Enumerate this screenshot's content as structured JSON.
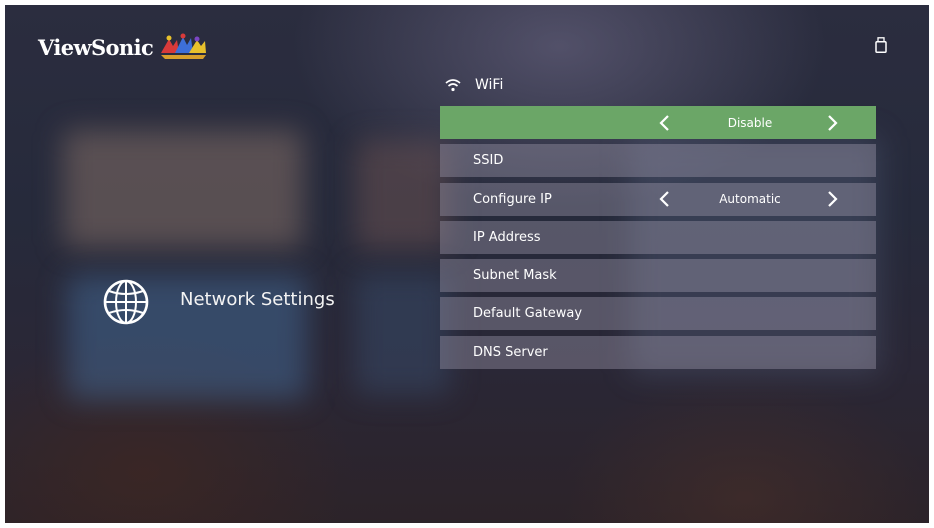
{
  "brand": {
    "name": "ViewSonic"
  },
  "section": {
    "title": "Network Settings",
    "icon": "globe-icon"
  },
  "wifi": {
    "label": "WiFi",
    "icon": "wifi-icon"
  },
  "status_icon": "usb-drive-icon",
  "menu": {
    "items": [
      {
        "label": "",
        "value": "Disable",
        "selected": true
      },
      {
        "label": "SSID"
      },
      {
        "label": "Configure IP",
        "value": "Automatic"
      },
      {
        "label": "IP Address"
      },
      {
        "label": "Subnet Mask"
      },
      {
        "label": "Default Gateway"
      },
      {
        "label": "DNS Server"
      }
    ]
  },
  "colors": {
    "selected_row": "#6ba667",
    "text": "#ffffff"
  }
}
